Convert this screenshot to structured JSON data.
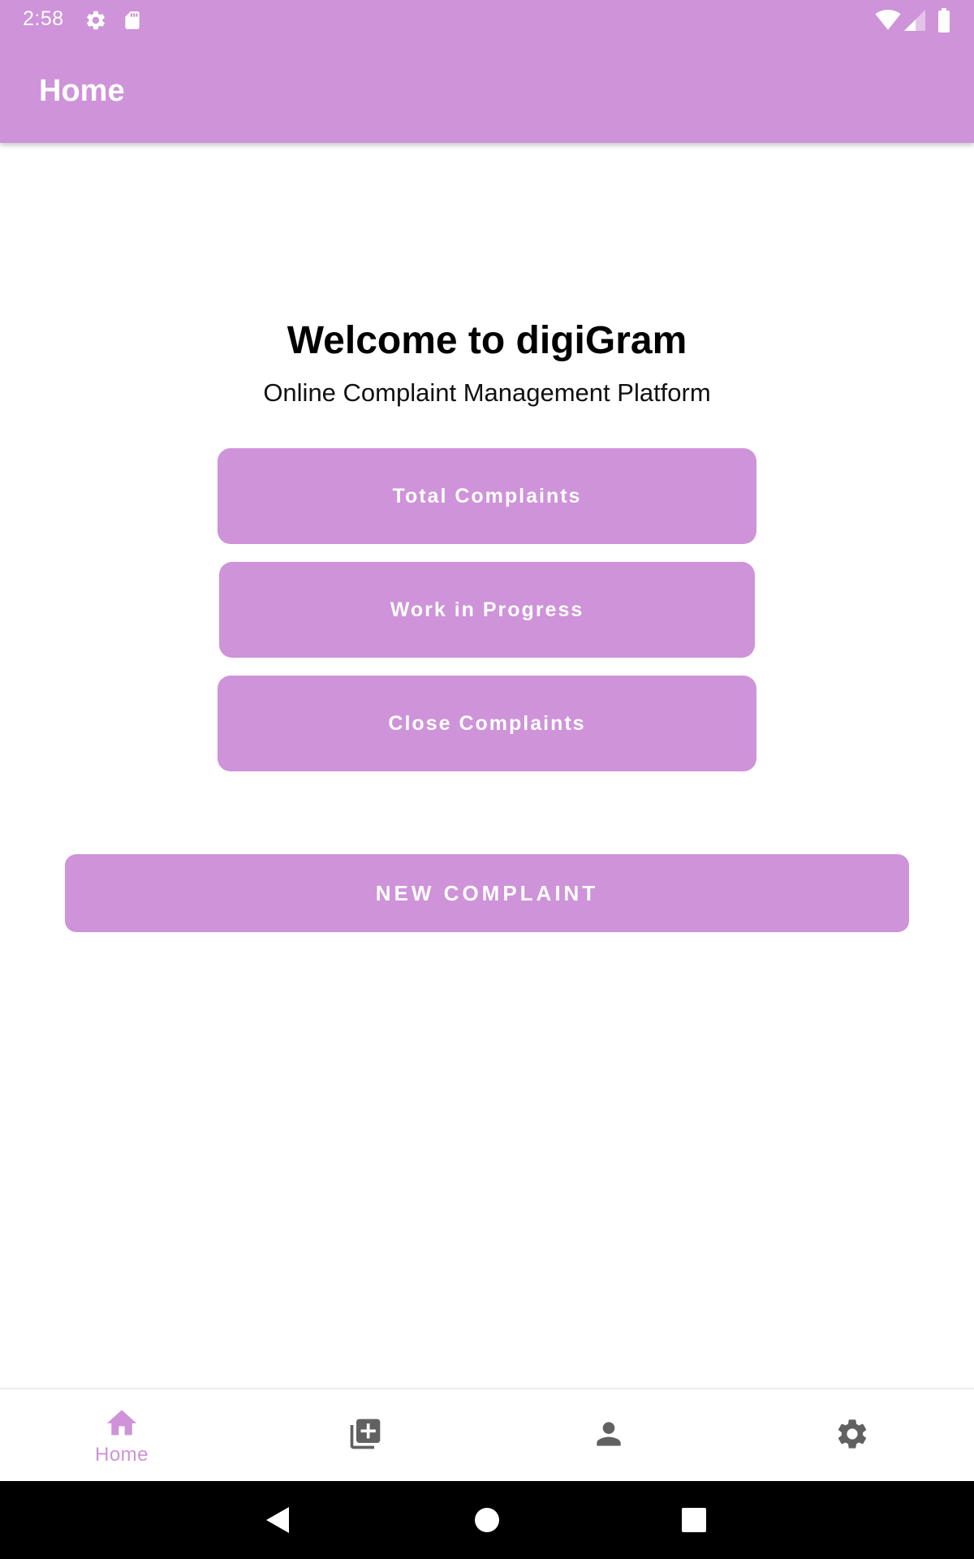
{
  "status_bar": {
    "time": "2:58",
    "icons": [
      "gear-icon",
      "sd-card-icon",
      "wifi-icon",
      "signal-icon",
      "battery-icon"
    ]
  },
  "app_bar": {
    "title": "Home",
    "color": "#ce93d8"
  },
  "main": {
    "welcome": "Welcome to digiGram",
    "subtitle": "Online Complaint Management Platform",
    "stat_buttons": [
      {
        "label": "Total Complaints"
      },
      {
        "label": "Work in Progress"
      },
      {
        "label": "Close Complaints"
      }
    ],
    "new_complaint_label": "NEW COMPLAINT"
  },
  "bottom_nav": {
    "items": [
      {
        "icon": "home-icon",
        "label": "Home",
        "active": true
      },
      {
        "icon": "add-library-icon",
        "label": "",
        "active": false
      },
      {
        "icon": "person-icon",
        "label": "",
        "active": false
      },
      {
        "icon": "settings-icon",
        "label": "",
        "active": false
      }
    ],
    "active_color": "#ce93d8",
    "inactive_color": "#616161"
  },
  "system_nav": {
    "icons": [
      "back-icon",
      "home-circle-icon",
      "recents-icon"
    ]
  }
}
